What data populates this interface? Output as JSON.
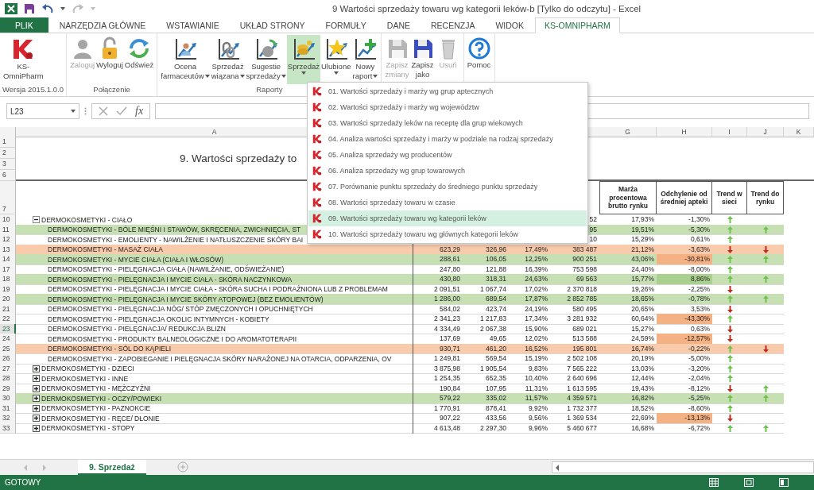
{
  "window": {
    "title": "9  Wartości sprzedaży towaru wg kategorii leków-b  [Tylko do odczytu] - Excel"
  },
  "tabs": [
    {
      "label": "PLIK",
      "kind": "file",
      "selected": false
    },
    {
      "label": "NARZĘDZIA GŁÓWNE",
      "kind": "tab",
      "selected": false
    },
    {
      "label": "WSTAWIANIE",
      "kind": "tab",
      "selected": false
    },
    {
      "label": "UKŁAD STRONY",
      "kind": "tab",
      "selected": false
    },
    {
      "label": "FORMUŁY",
      "kind": "tab",
      "selected": false
    },
    {
      "label": "DANE",
      "kind": "tab",
      "selected": false
    },
    {
      "label": "RECENZJA",
      "kind": "tab",
      "selected": false
    },
    {
      "label": "WIDOK",
      "kind": "tab",
      "selected": false
    },
    {
      "label": "KS-OMNIPHARM",
      "kind": "tab",
      "selected": true
    }
  ],
  "ribbon": {
    "groups": [
      {
        "label": "Wersja 2015.1.0.0",
        "buttons": [
          {
            "kind": "logo",
            "lines": [
              "KS-",
              "OmniPharm"
            ],
            "dropdown": false,
            "disabled": false,
            "selected": false
          }
        ]
      },
      {
        "label": "Połączenie",
        "buttons": [
          {
            "kind": "login",
            "lines": [
              "Zaloguj"
            ],
            "dropdown": false,
            "disabled": true,
            "selected": false
          },
          {
            "kind": "logout",
            "lines": [
              "Wyloguj"
            ],
            "dropdown": false,
            "disabled": false,
            "selected": false
          },
          {
            "kind": "refresh",
            "lines": [
              "Odśwież"
            ],
            "dropdown": false,
            "disabled": false,
            "selected": false
          }
        ]
      },
      {
        "label": "Raporty",
        "buttons": [
          {
            "kind": "rating",
            "lines": [
              "Ocena",
              "farmaceutów"
            ],
            "dropdown": true,
            "disabled": false,
            "selected": false
          },
          {
            "kind": "linked",
            "lines": [
              "Sprzedaż",
              "wiązana"
            ],
            "dropdown": true,
            "disabled": false,
            "selected": false
          },
          {
            "kind": "suggest",
            "lines": [
              "Sugestie",
              "sprzedaży"
            ],
            "dropdown": true,
            "disabled": false,
            "selected": false
          },
          {
            "kind": "sales",
            "lines": [
              "Sprzedaż"
            ],
            "dropdown": true,
            "disabled": false,
            "selected": true
          },
          {
            "kind": "favorite",
            "lines": [
              "Ulubione"
            ],
            "dropdown": true,
            "disabled": false,
            "selected": false
          },
          {
            "kind": "new",
            "lines": [
              "Nowy",
              "raport"
            ],
            "dropdown": true,
            "disabled": false,
            "selected": false
          }
        ]
      },
      {
        "buttons": [
          {
            "kind": "save",
            "lines": [
              "Zapisz",
              "zmiany"
            ],
            "dropdown": false,
            "disabled": true,
            "selected": false
          },
          {
            "kind": "saveas",
            "lines": [
              "Zapisz",
              "jako"
            ],
            "dropdown": false,
            "disabled": false,
            "selected": false
          },
          {
            "kind": "delete",
            "lines": [
              "Usuń"
            ],
            "dropdown": false,
            "disabled": true,
            "selected": false
          }
        ]
      },
      {
        "buttons": [
          {
            "kind": "help",
            "lines": [
              "Pomoc"
            ],
            "dropdown": false,
            "disabled": false,
            "selected": false
          }
        ]
      }
    ]
  },
  "menu": [
    {
      "label": "01. Wartości sprzedaży i marży wg grup aptecznych",
      "selected": false
    },
    {
      "label": "02. Wartości sprzedaży i marży wg województw",
      "selected": false
    },
    {
      "label": "03. Wartości sprzedaży leków na receptę dla grup wiekowych",
      "selected": false
    },
    {
      "label": "04. Analiza wartości sprzedaży i marży w podziale na rodzaj sprzedaży",
      "selected": false
    },
    {
      "label": "05. Analiza sprzedaży wg producentów",
      "selected": false
    },
    {
      "label": "06. Analiza sprzedaży wg grup towarowych",
      "selected": false
    },
    {
      "label": "07. Porównanie punktu sprzedaży do średniego punktu sprzedaży",
      "selected": false
    },
    {
      "label": "08. Wartości sprzedaży towaru w czasie",
      "selected": false
    },
    {
      "label": "09. Wartości sprzedaży towaru wg kategorii leków",
      "selected": true
    },
    {
      "label": "10. Wartości sprzedaży towaru wg głównych kategorii leków",
      "selected": false
    }
  ],
  "formula_bar": {
    "name_box": "L23",
    "fx": "fx"
  },
  "sheet": {
    "column_letters": [
      "A",
      "G",
      "H",
      "I",
      "J",
      "K"
    ],
    "title_rows": [
      "1",
      "2",
      "3",
      "6"
    ],
    "title": "9. Wartości sprzedaży to",
    "header_row": "7",
    "headers": [
      "Marża procentowa brutto rynku",
      "Odchylenie od średniej apteki",
      "Trend w sieci",
      "Trend do rynku"
    ],
    "rows": [
      {
        "num": "10",
        "label": "DERMOKOSMETYKI - CIAŁO",
        "expanded": true,
        "selected": false,
        "values": {
          "col_e": "52",
          "marza": "17,93%"
        },
        "deviation": {
          "text": "-1,30%"
        },
        "sieci_up": true,
        "children": [
          {
            "num": "11",
            "label": "DERMOKOSMETYKI - BÓLE MIĘŚNI I STAWÓW, SKRĘCENIA, ZWICHNIĘCIA, ST",
            "selected": false,
            "color": "#c6e0b4",
            "values": {
              "col_e": "95",
              "marza": "19,51%"
            },
            "deviation": {
              "text": "-5,30%"
            },
            "sieci_up": true,
            "rynku_up": true
          },
          {
            "num": "12",
            "label": "DERMOKOSMETYKI - EMOLIENTY - NAWILŻENIE I NATŁUSZCZENIE SKÓRY BAI",
            "selected": false,
            "values": {
              "col_e": "10",
              "marza": "15,29%"
            },
            "deviation": {
              "text": "0,61%"
            },
            "sieci_up": true
          },
          {
            "num": "13",
            "label": "DERMOKOSMETYKI - MASAŻ CIAŁA",
            "selected": false,
            "color": "#f8cbad",
            "values": {
              "col_b": "623,29",
              "col_c": "326,96",
              "col_d": "17,49%",
              "col_e": "383 487",
              "marza": "21,12%"
            },
            "deviation": {
              "text": "-3,63%"
            },
            "sieci_up": false,
            "rynku_up": false
          },
          {
            "num": "14",
            "label": "DERMOKOSMETYKI - MYCIE CIAŁA (CIAŁA I WŁOSÓW)",
            "selected": false,
            "color": "#c6e0b4",
            "values": {
              "col_b": "288,61",
              "col_c": "106,05",
              "col_d": "12,25%",
              "col_e": "900 251",
              "marza": "43,06%"
            },
            "deviation": {
              "text": "-30,81%",
              "color": "#f4b183"
            },
            "sieci_up": true,
            "rynku_up": true
          },
          {
            "num": "17",
            "label": "DERMOKOSMETYKI - PIELĘGNACJA CIAŁA (NAWILŻANIE, ODŚWIEŻANIE)",
            "selected": false,
            "values": {
              "col_b": "247,80",
              "col_c": "121,88",
              "col_d": "16,39%",
              "col_e": "753 598",
              "marza": "24,40%"
            },
            "deviation": {
              "text": "-8,00%"
            },
            "sieci_up": true
          },
          {
            "num": "18",
            "label": "DERMOKOSMETYKI - PIELĘGNACJA I MYCIE CIAŁA - SKÓRA NACZYNKOWA",
            "selected": false,
            "color": "#c6e0b4",
            "values": {
              "col_b": "430,80",
              "col_c": "318,31",
              "col_d": "24,63%",
              "col_e": "69 563",
              "marza": "15,77%"
            },
            "deviation": {
              "text": "8,86%",
              "color": "#a9d08e"
            },
            "sieci_up": true,
            "rynku_up": true
          },
          {
            "num": "19",
            "label": "DERMOKOSMETYKI - PIELĘGNACJA I MYCIE CIAŁA - SKÓRA SUCHA I PODRAŻNIONA LUB Z PROBLEMAM",
            "selected": false,
            "values": {
              "col_b": "2 091,51",
              "col_c": "1 067,74",
              "col_d": "17,02%",
              "col_e": "2 370 818",
              "marza": "19,26%"
            },
            "deviation": {
              "text": "-2,25%"
            },
            "sieci_up": false
          },
          {
            "num": "20",
            "label": "DERMOKOSMETYKI - PIELĘGNACJA I MYCIE SKÓRY ATOPOWEJ (BEZ EMOLIENTÓW)",
            "selected": false,
            "color": "#c6e0b4",
            "values": {
              "col_b": "1 286,00",
              "col_c": "689,54",
              "col_d": "17,87%",
              "col_e": "2 852 785",
              "marza": "18,65%"
            },
            "deviation": {
              "text": "-0,78%"
            },
            "sieci_up": true,
            "rynku_up": true
          },
          {
            "num": "21",
            "label": "DERMOKOSMETYKI - PIELĘGNACJA NÓG/ STÓP ZMĘCZONYCH I OPUCHNIĘTYCH",
            "selected": false,
            "values": {
              "col_b": "584,02",
              "col_c": "423,74",
              "col_d": "24,19%",
              "col_e": "580 495",
              "marza": "20,65%"
            },
            "deviation": {
              "text": "3,53%"
            },
            "sieci_up": false
          },
          {
            "num": "22",
            "label": "DERMOKOSMETYKI - PIELĘGNACJA OKOLIC INTYMNYCH - KOBIETY",
            "selected": false,
            "values": {
              "col_b": "2 341,23",
              "col_c": "1 217,83",
              "col_d": "17,34%",
              "col_e": "3 281 932",
              "marza": "60,64%"
            },
            "deviation": {
              "text": "-43,30%",
              "color": "#f4b183"
            },
            "sieci_up": true
          },
          {
            "num": "23",
            "label": "DERMOKOSMETYKI - PIELĘGNACJA/ REDUKCJA BLIZN",
            "selected": true,
            "values": {
              "col_b": "4 334,49",
              "col_c": "2 067,38",
              "col_d": "15,90%",
              "col_e": "689 021",
              "marza": "15,27%"
            },
            "deviation": {
              "text": "0,63%"
            },
            "sieci_up": false
          },
          {
            "num": "24",
            "label": "DERMOKOSMETYKI - PRODUKTY BALNEOLOGICZNE I DO AROMATOTERAPII",
            "selected": false,
            "values": {
              "col_b": "137,69",
              "col_c": "49,65",
              "col_d": "12,02%",
              "col_e": "513 588",
              "marza": "24,59%"
            },
            "deviation": {
              "text": "-12,57%",
              "color": "#f4b183"
            },
            "sieci_up": false
          },
          {
            "num": "25",
            "label": "DERMOKOSMETYKI - SÓL DO KĄPIELI",
            "selected": false,
            "color": "#f8cbad",
            "values": {
              "col_b": "930,71",
              "col_c": "461,20",
              "col_d": "16,52%",
              "col_e": "195 801",
              "marza": "16,74%"
            },
            "deviation": {
              "text": "-0,22%"
            },
            "sieci_up": true,
            "rynku_up": false
          },
          {
            "num": "26",
            "label": "DERMOKOSMETYKI - ZAPOBIEGANIE I PIELĘGNACJA SKÓRY NARAŻONEJ NA OTARCIA, ODPARZENIA, OV",
            "selected": false,
            "values": {
              "col_b": "1 249,81",
              "col_c": "569,54",
              "col_d": "15,19%",
              "col_e": "2 502 108",
              "marza": "20,19%"
            },
            "deviation": {
              "text": "-5,00%"
            },
            "sieci_up": true
          }
        ]
      },
      {
        "num": "27",
        "label": "DERMOKOSMETYKI - DZIECI",
        "expanded": false,
        "selected": false,
        "values": {
          "col_b": "3 875,98",
          "col_c": "1 905,54",
          "col_d": "9,83%",
          "col_e": "7 565 222",
          "marza": "13,03%"
        },
        "deviation": {
          "text": "-3,20%"
        },
        "sieci_up": true
      },
      {
        "num": "28",
        "label": "DERMOKOSMETYKI - INNE",
        "expanded": false,
        "selected": false,
        "values": {
          "col_b": "1 254,35",
          "col_c": "652,35",
          "col_d": "10,40%",
          "col_e": "2 640 696",
          "marza": "12,44%"
        },
        "deviation": {
          "text": "-2,04%"
        },
        "sieci_up": true
      },
      {
        "num": "29",
        "label": "DERMOKOSMETYKI - MĘŻCZYŹNI",
        "expanded": false,
        "selected": false,
        "values": {
          "col_b": "190,84",
          "col_c": "107,95",
          "col_d": "11,31%",
          "col_e": "1 613 595",
          "marza": "19,43%"
        },
        "deviation": {
          "text": "-8,12%"
        },
        "sieci_up": false,
        "rynku_up": true
      },
      {
        "num": "30",
        "label": "DERMOKOSMETYKI - OCZY/POWIEKI",
        "expanded": false,
        "selected": false,
        "color": "#c6e0b4",
        "values": {
          "col_b": "579,22",
          "col_c": "335,02",
          "col_d": "11,57%",
          "col_e": "4 359 571",
          "marza": "16,82%"
        },
        "deviation": {
          "text": "-5,25%"
        },
        "sieci_up": true,
        "rynku_up": true
      },
      {
        "num": "31",
        "label": "DERMOKOSMETYKI - PAZNOKCIE",
        "expanded": false,
        "selected": false,
        "values": {
          "col_b": "1 770,91",
          "col_c": "878,41",
          "col_d": "9,92%",
          "col_e": "1 732 377",
          "marza": "18,52%"
        },
        "deviation": {
          "text": "-8,60%"
        },
        "sieci_up": true
      },
      {
        "num": "32",
        "label": "DERMOKOSMETYKI - RĘCE/ DŁONIE",
        "expanded": false,
        "selected": false,
        "values": {
          "col_b": "907,22",
          "col_c": "433,56",
          "col_d": "9,56%",
          "col_e": "1 369 534",
          "marza": "22,69%"
        },
        "deviation": {
          "text": "-13,13%",
          "color": "#f4b183"
        },
        "sieci_up": false
      },
      {
        "num": "33",
        "label": "DERMOKOSMETYKI - STOPY",
        "expanded": false,
        "selected": false,
        "values": {
          "col_b": "4 613,48",
          "col_c": "2 297,30",
          "col_d": "9,96%",
          "col_e": "5 460 677",
          "marza": "16,68%"
        },
        "deviation": {
          "text": "-6,72%"
        },
        "sieci_up": true,
        "rynku_up": true
      }
    ]
  },
  "sheet_tabs": [
    {
      "label": "9. Sprzedaż",
      "selected": true
    }
  ],
  "status_bar": {
    "text": "GOTOWY"
  }
}
